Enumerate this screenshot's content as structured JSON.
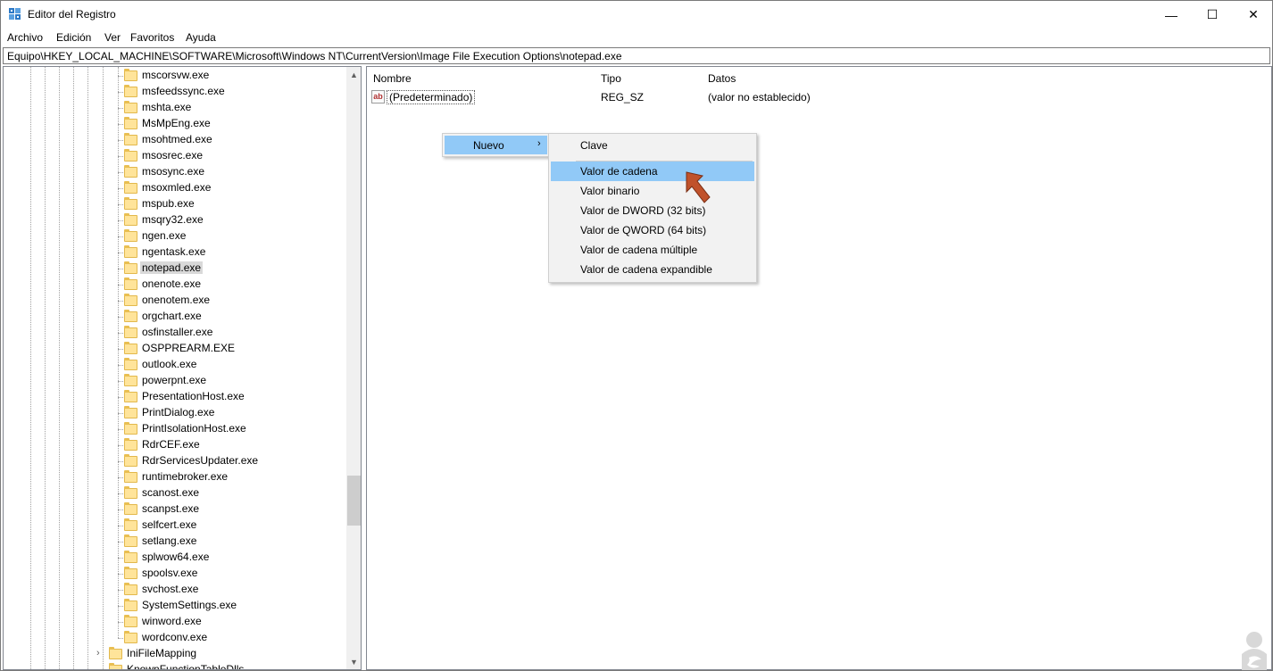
{
  "window": {
    "title": "Editor del Registro",
    "controls": {
      "minimize": "—",
      "maximize": "☐",
      "close": "✕"
    }
  },
  "menubar": [
    "Archivo",
    "Edición",
    "Ver",
    "Favoritos",
    "Ayuda"
  ],
  "address": "Equipo\\HKEY_LOCAL_MACHINE\\SOFTWARE\\Microsoft\\Windows NT\\CurrentVersion\\Image File Execution Options\\notepad.exe",
  "tree": {
    "items": [
      "mscorsvw.exe",
      "msfeedssync.exe",
      "mshta.exe",
      "MsMpEng.exe",
      "msohtmed.exe",
      "msosrec.exe",
      "msosync.exe",
      "msoxmled.exe",
      "mspub.exe",
      "msqry32.exe",
      "ngen.exe",
      "ngentask.exe",
      "notepad.exe",
      "onenote.exe",
      "onenotem.exe",
      "orgchart.exe",
      "osfinstaller.exe",
      "OSPPREARM.EXE",
      "outlook.exe",
      "powerpnt.exe",
      "PresentationHost.exe",
      "PrintDialog.exe",
      "PrintIsolationHost.exe",
      "RdrCEF.exe",
      "RdrServicesUpdater.exe",
      "runtimebroker.exe",
      "scanost.exe",
      "scanpst.exe",
      "selfcert.exe",
      "setlang.exe",
      "splwow64.exe",
      "spoolsv.exe",
      "svchost.exe",
      "SystemSettings.exe",
      "winword.exe",
      "wordconv.exe"
    ],
    "selected": "notepad.exe",
    "root_items": [
      "IniFileMapping",
      "KnownFunctionTableDlls"
    ],
    "expander_glyph": "›",
    "scroll_up_glyph": "▲",
    "scroll_down_glyph": "▼"
  },
  "list": {
    "headers": {
      "name": "Nombre",
      "type": "Tipo",
      "data": "Datos"
    },
    "rows": [
      {
        "icon": "ab",
        "name": "(Predeterminado)",
        "type": "REG_SZ",
        "data": "(valor no establecido)"
      }
    ]
  },
  "context_menu": {
    "nuevo": {
      "label": "Nuevo",
      "arrow": "›"
    },
    "submenu": {
      "items": [
        "Clave",
        "Valor de cadena",
        "Valor binario",
        "Valor de DWORD (32 bits)",
        "Valor de QWORD (64 bits)",
        "Valor de cadena múltiple",
        "Valor de cadena expandible"
      ],
      "highlighted": "Valor de cadena"
    }
  },
  "colors": {
    "menu_highlight": "#91c9f7",
    "folder": "#ffe49a",
    "pointer_arrow": "#c0522b"
  },
  "icons": {
    "app": "registry-editor-icon",
    "pointer": "red-pointer-arrow-icon",
    "watermark": "solvetic-logo-icon"
  }
}
